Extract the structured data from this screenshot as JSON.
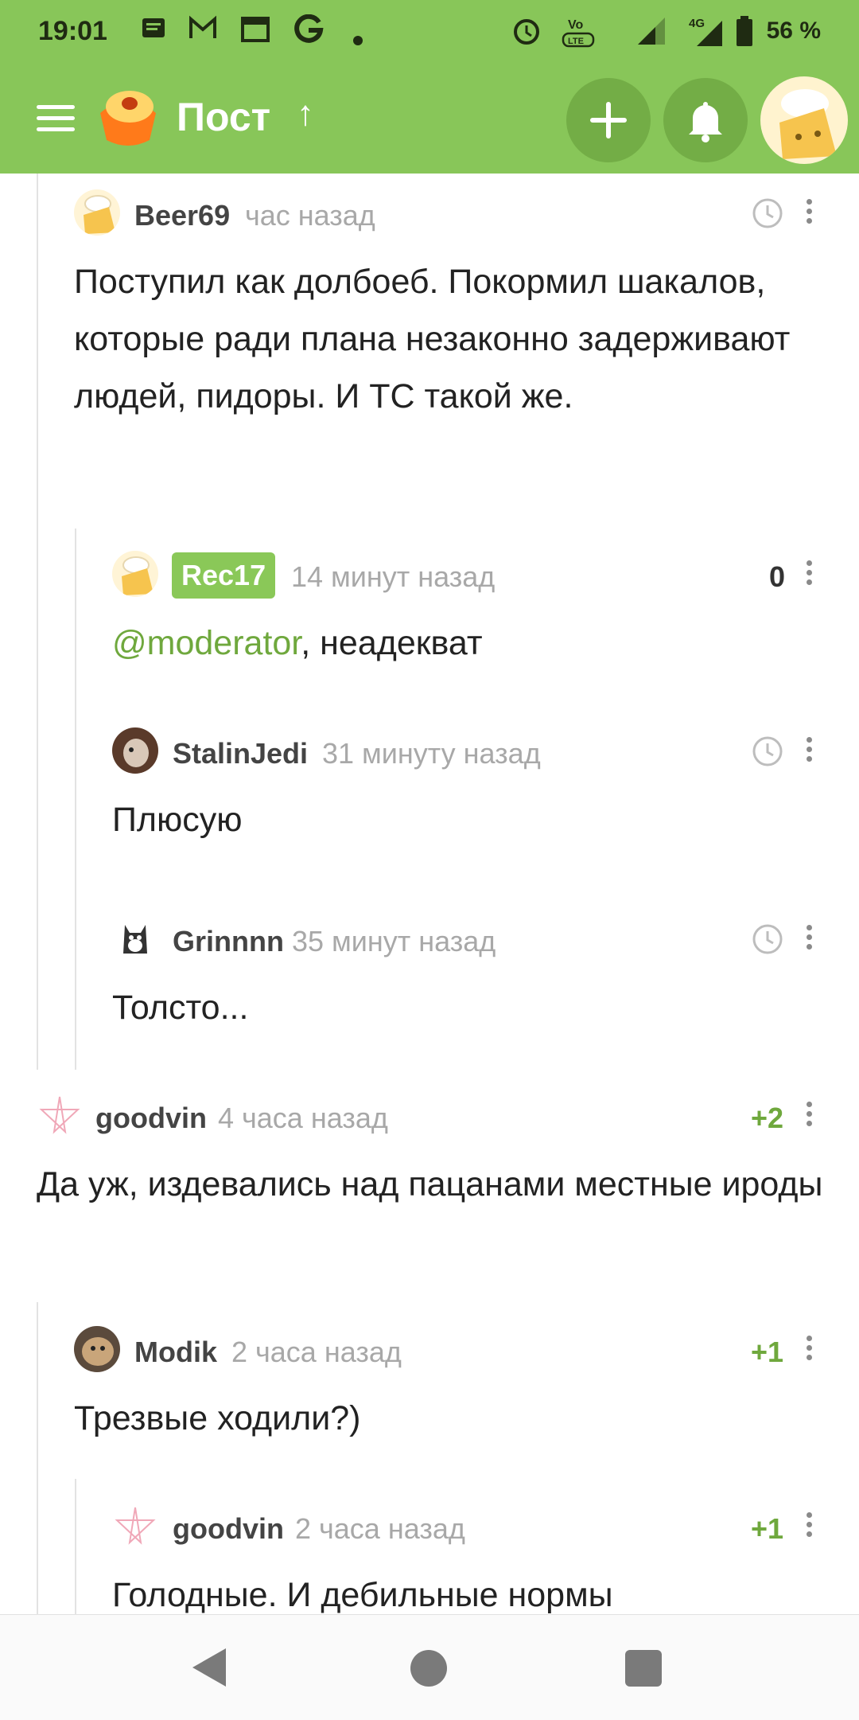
{
  "status_bar": {
    "time": "19:01",
    "battery": "56 %"
  },
  "header": {
    "title": "Пост"
  },
  "comments": [
    {
      "author": "Beer69",
      "time": "час назад",
      "text": "Поступил как долбоеб. Покормил шакалов, которые ради плана незаконно задерживают людей, пидоры. И ТС такой же."
    },
    {
      "author": "Rec17",
      "time": "14 минут назад",
      "rating": "0",
      "mention": "@moderator",
      "text": ", неадекват"
    },
    {
      "author": "StalinJedi",
      "time": "31 минуту назад",
      "text": "Плюсую"
    },
    {
      "author": "Grinnnn",
      "time": "35 минут назад",
      "text": "Толсто..."
    },
    {
      "author": "goodvin",
      "time": "4 часа назад",
      "rating": "+2",
      "text": "Да уж, издевались над пацанами местные ироды"
    },
    {
      "author": "Modik",
      "time": "2 часа назад",
      "rating": "+1",
      "text": "Трезвые ходили?)"
    },
    {
      "author": "goodvin",
      "time": "2 часа назад",
      "rating": "+1",
      "text": "Голодные. И дебильные нормы"
    }
  ],
  "colors": {
    "brand_green": "#88c659",
    "rating_green": "#6fa83d",
    "badge_green": "#8ac858"
  }
}
